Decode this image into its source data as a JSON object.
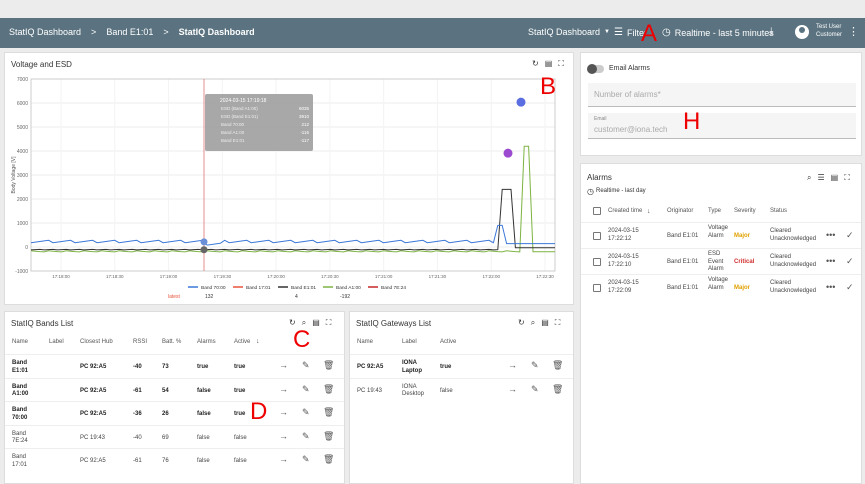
{
  "topbar": {
    "crumb1": "StatIQ Dashboard",
    "sep": ">",
    "crumb2": "Band E1:01",
    "crumb3": "StatIQ Dashboard",
    "dash_select": "StatIQ Dashboard",
    "filter": "Filter",
    "realtime": "Realtime - last 5 minutes",
    "user": "Test User",
    "role": "Customer"
  },
  "chart_panel": {
    "title": "Voltage and ESD"
  },
  "chart_data": {
    "type": "line",
    "ylabel": "Body Voltage [V]",
    "ylim": [
      -1000,
      7000
    ],
    "yticks": [
      "7000",
      "6000",
      "5000",
      "4000",
      "3000",
      "2000",
      "1000",
      "0",
      "-1000"
    ],
    "xticks": [
      "17:18:00",
      "17:18:30",
      "17:19:00",
      "17:19:30",
      "17:20:00",
      "17:20:30",
      "17:21:00",
      "17:21:30",
      "17:22:00",
      "17:22:30"
    ],
    "tooltip": {
      "time": "2024-03-15 17:19:18",
      "rows": [
        [
          "ESD (Band A1:00)",
          "6035"
        ],
        [
          "ESD (Band E1:01)",
          "3910"
        ],
        [
          "Band 70:00",
          "212"
        ],
        [
          "Band A1:00",
          "-116"
        ],
        [
          "Band E1:01",
          "-117"
        ]
      ]
    },
    "series": [
      {
        "name": "Band 70:00",
        "color": "#3b78d8",
        "latest": "132"
      },
      {
        "name": "Band 17:01",
        "color": "#e8543c",
        "latest": ""
      },
      {
        "name": "Band E1:01",
        "color": "#333333",
        "latest": "4"
      },
      {
        "name": "Band A1:00",
        "color": "#7cb342",
        "latest": "-192"
      },
      {
        "name": "Band 7E:24",
        "color": "#c62828",
        "latest": ""
      }
    ],
    "latest_label": "latest"
  },
  "email": {
    "toggle_label": "Email Alarms",
    "num_placeholder": "Number of alarms*",
    "email_label": "Email",
    "email_placeholder": "customer@iona.tech"
  },
  "alarms": {
    "title": "Alarms",
    "sub": "Realtime - last day",
    "headers": [
      "Created time",
      "Originator",
      "Type",
      "Severity",
      "Status"
    ],
    "rows": [
      {
        "time": "2024-03-15 17:22:12",
        "orig": "Band E1:01",
        "type": "Voltage Alarm",
        "sev": "Major",
        "status": "Cleared Unacknowledged",
        "sevcolor": "#e0a000"
      },
      {
        "time": "2024-03-15 17:22:10",
        "orig": "Band E1:01",
        "type": "ESD Event Alarm",
        "sev": "Critical",
        "status": "Cleared Unacknowledged",
        "sevcolor": "#d32f2f"
      },
      {
        "time": "2024-03-15 17:22:09",
        "orig": "Band E1:01",
        "type": "Voltage Alarm",
        "sev": "Major",
        "status": "Cleared Unacknowledged",
        "sevcolor": "#e0a000"
      }
    ]
  },
  "bands": {
    "title": "StatIQ Bands List",
    "headers": [
      "Name",
      "Label",
      "Closest Hub",
      "RSSI",
      "Batt. %",
      "Alarms",
      "Active"
    ],
    "rows": [
      {
        "name": "Band E1:01",
        "hub": "PC 92:A5",
        "rssi": "-40",
        "batt": "73",
        "alarms": "true",
        "active": "true",
        "bold": true
      },
      {
        "name": "Band A1:00",
        "hub": "PC 92:A5",
        "rssi": "-61",
        "batt": "54",
        "alarms": "false",
        "active": "true",
        "bold": true
      },
      {
        "name": "Band 70:00",
        "hub": "PC 92:A5",
        "rssi": "-36",
        "batt": "26",
        "alarms": "false",
        "active": "true",
        "bold": true
      },
      {
        "name": "Band 7E:24",
        "hub": "PC 19:43",
        "rssi": "-40",
        "batt": "69",
        "alarms": "false",
        "active": "false",
        "bold": false
      },
      {
        "name": "Band 17:01",
        "hub": "PC 92:A5",
        "rssi": "-61",
        "batt": "76",
        "alarms": "false",
        "active": "false",
        "bold": false
      }
    ]
  },
  "gateways": {
    "title": "StatIQ Gateways List",
    "headers": [
      "Name",
      "Label",
      "Active"
    ],
    "rows": [
      {
        "name": "PC 92:A5",
        "label": "IONA Laptop",
        "active": "true",
        "bold": true
      },
      {
        "name": "PC 19:43",
        "label": "IONA Desktop",
        "active": "false",
        "bold": false
      }
    ]
  },
  "markers": {
    "a": "A",
    "b": "B",
    "c": "C",
    "d": "D",
    "h": "H"
  }
}
